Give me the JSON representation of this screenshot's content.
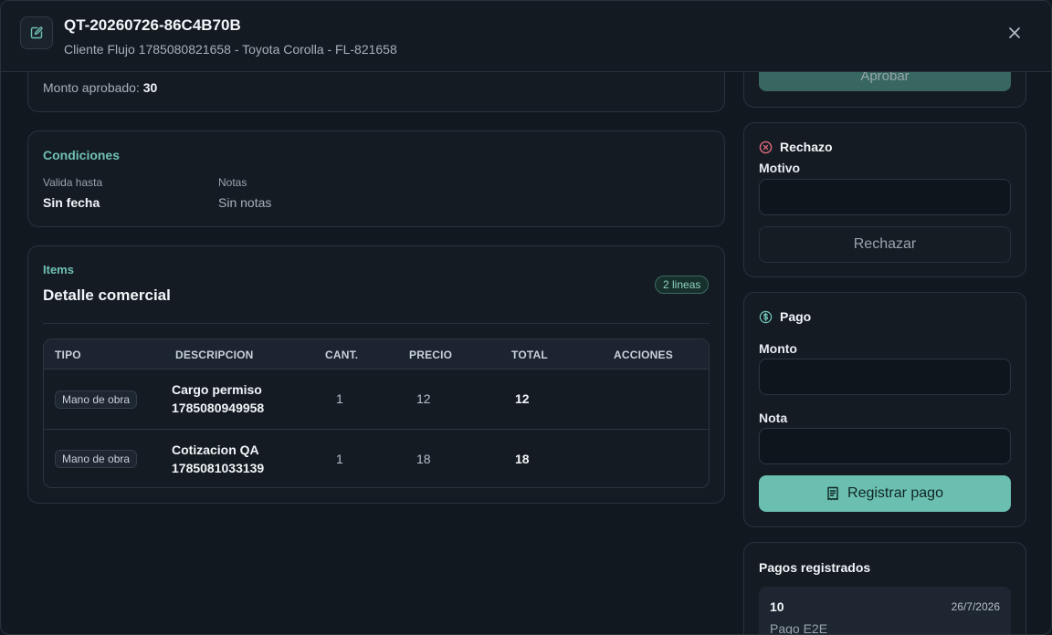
{
  "header": {
    "title": "QT-20260726-86C4B70B",
    "subtitle": "Cliente Flujo 1785080821658 - Toyota Corolla - FL-821658"
  },
  "summary": {
    "approved_label": "Monto aprobado:",
    "approved_value": "30"
  },
  "conditions": {
    "title": "Condiciones",
    "valid_until_label": "Valida hasta",
    "valid_until_value": "Sin fecha",
    "notes_label": "Notas",
    "notes_value": "Sin notas"
  },
  "items": {
    "kicker": "Items",
    "title": "Detalle comercial",
    "count_badge": "2 lineas",
    "columns": [
      "TIPO",
      "DESCRIPCION",
      "CANT.",
      "PRECIO",
      "TOTAL",
      "ACCIONES"
    ],
    "rows": [
      {
        "type": "Mano de obra",
        "desc_line1": "Cargo permiso",
        "desc_line2": "1785080949958",
        "qty": "1",
        "price": "12",
        "total": "12"
      },
      {
        "type": "Mano de obra",
        "desc_line1": "Cotizacion QA",
        "desc_line2": "1785081033139",
        "qty": "1",
        "price": "18",
        "total": "18"
      }
    ]
  },
  "approve": {
    "button_label": "Aprobar"
  },
  "reject": {
    "title": "Rechazo",
    "reason_label": "Motivo",
    "reason_value": "",
    "button_label": "Rechazar"
  },
  "payment": {
    "title": "Pago",
    "amount_label": "Monto",
    "amount_value": "",
    "note_label": "Nota",
    "note_value": "",
    "button_label": "Registrar pago"
  },
  "payments_list": {
    "title": "Pagos registrados",
    "items": [
      {
        "amount": "10",
        "date": "26/7/2026",
        "note": "Pago E2E"
      }
    ]
  },
  "colors": {
    "accent": "#6bbfb0",
    "danger": "#e06a7a",
    "background": "#121820"
  },
  "icons": {
    "header": "edit-document-icon",
    "close": "close-icon",
    "reject": "x-circle-icon",
    "payment": "dollar-circle-icon",
    "register": "receipt-icon"
  }
}
